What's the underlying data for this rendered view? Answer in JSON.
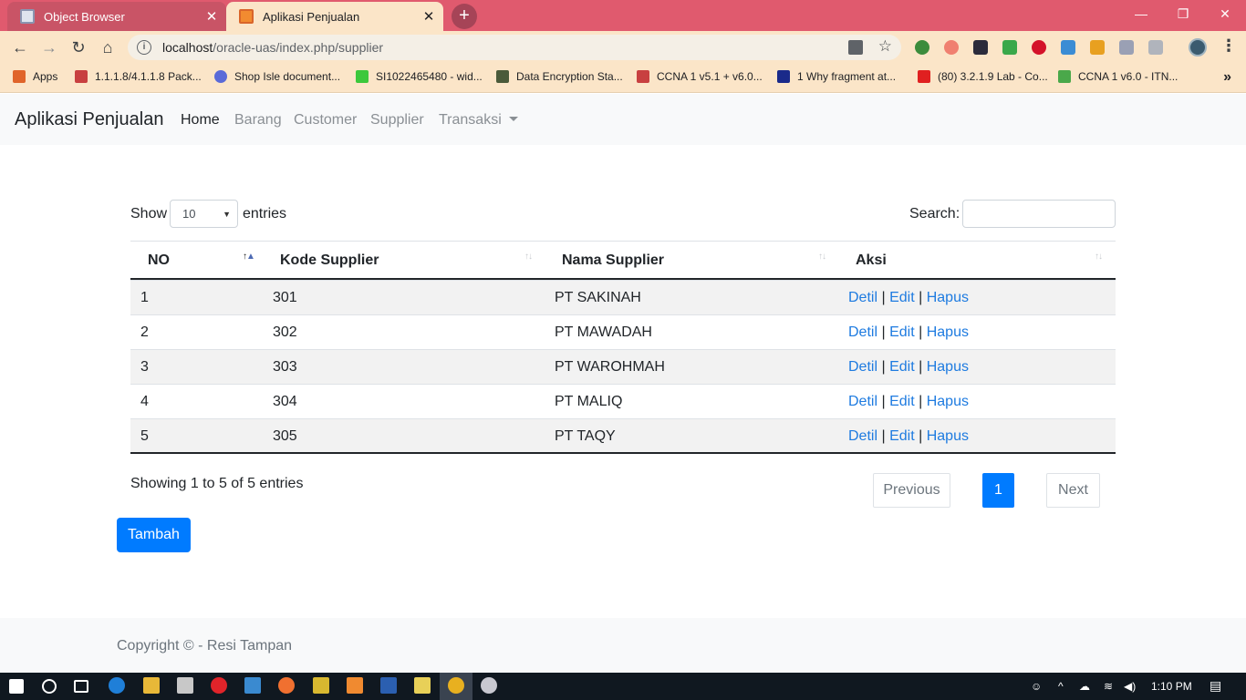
{
  "browser": {
    "tabs": [
      {
        "title": "Object Browser",
        "active": false
      },
      {
        "title": "Aplikasi Penjualan",
        "active": true
      }
    ],
    "url_host": "localhost",
    "url_path": "/oracle-uas/index.php/supplier",
    "bookmarks": [
      "Apps",
      "1.1.1.8/4.1.1.8 Pack...",
      "Shop Isle document...",
      "SI1022465480 - wid...",
      "Data Encryption Sta...",
      "CCNA 1 v5.1 + v6.0...",
      "1 Why fragment at...",
      "(80) 3.2.1.9 Lab - Co...",
      "CCNA 1 v6.0 - ITN..."
    ],
    "more_bookmarks": "»"
  },
  "navbar": {
    "brand": "Aplikasi Penjualan",
    "links": [
      "Home",
      "Barang",
      "Customer",
      "Supplier",
      "Transaksi"
    ]
  },
  "table_controls": {
    "show_label": "Show",
    "page_length": "10",
    "entries_label": "entries",
    "search_label": "Search:"
  },
  "table": {
    "columns": [
      "NO",
      "Kode Supplier",
      "Nama Supplier",
      "Aksi"
    ],
    "rows": [
      {
        "no": "1",
        "kode": "301",
        "nama": "PT SAKINAH"
      },
      {
        "no": "2",
        "kode": "302",
        "nama": "PT MAWADAH"
      },
      {
        "no": "3",
        "kode": "303",
        "nama": "PT WAROHMAH"
      },
      {
        "no": "4",
        "kode": "304",
        "nama": "PT MALIQ"
      },
      {
        "no": "5",
        "kode": "305",
        "nama": "PT TAQY"
      }
    ],
    "actions": {
      "detil": "Detil",
      "edit": "Edit",
      "hapus": "Hapus",
      "separator": "|"
    }
  },
  "table_info": "Showing 1 to 5 of 5 entries",
  "pagination": {
    "previous": "Previous",
    "current": "1",
    "next": "Next"
  },
  "add_button": "Tambah",
  "footer": "Copyright © - Resi Tampan",
  "taskbar": {
    "clock": "1:10 PM"
  },
  "colors": {
    "primary": "#007bff",
    "link": "#1e7be0",
    "tabstrip": "#e05a6e",
    "toolbar": "#fbe5c8"
  }
}
